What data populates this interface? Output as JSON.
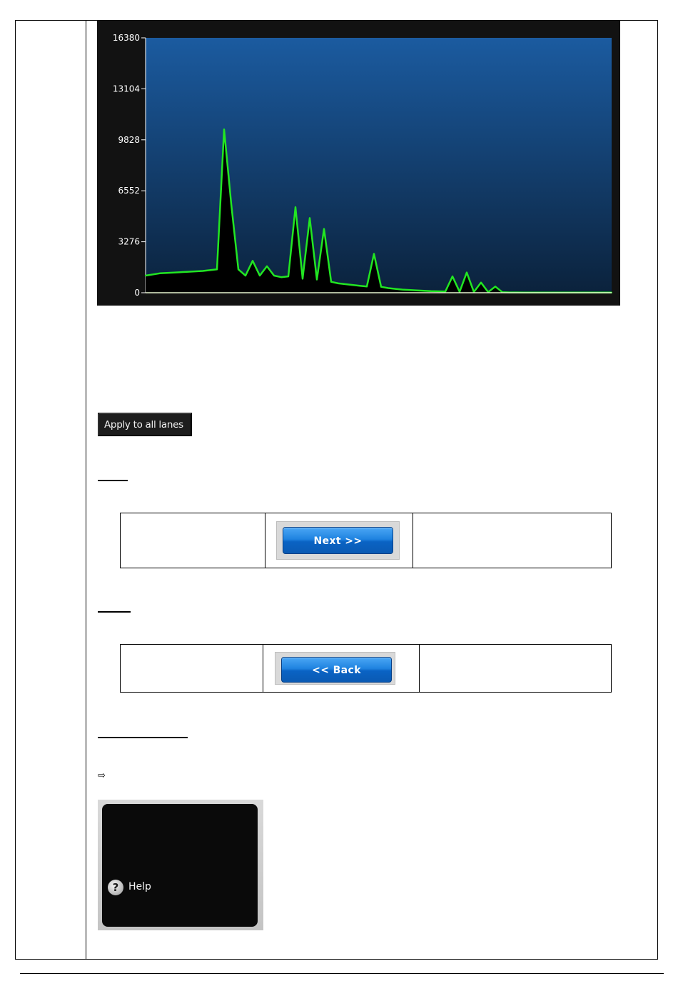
{
  "chart_data": {
    "type": "line",
    "title": "",
    "xlabel": "",
    "ylabel": "",
    "ylim": [
      0,
      16380
    ],
    "yticks": [
      0,
      3276,
      6552,
      9828,
      13104,
      16380
    ],
    "ytick_labels": [
      "0",
      "3276",
      "6552",
      "9828",
      "13104",
      "16380"
    ],
    "grid": false,
    "colors": {
      "background_top": "#1b5ba0",
      "background_bottom": "#0b223c",
      "trace": "#22e622",
      "baseline": "#000000"
    },
    "x": [
      0,
      20,
      40,
      60,
      80,
      100,
      110,
      120,
      130,
      140,
      150,
      160,
      170,
      180,
      190,
      200,
      210,
      220,
      230,
      240,
      250,
      260,
      270,
      280,
      290,
      300,
      310,
      320,
      330,
      340,
      350,
      360,
      380,
      400,
      420,
      430,
      440,
      450,
      460,
      470,
      480,
      490,
      500,
      510,
      520,
      530,
      540,
      560,
      580,
      600,
      620,
      640,
      653
    ],
    "series": [
      {
        "values": [
          1100,
          1250,
          1300,
          1350,
          1400,
          1500,
          10500,
          5700,
          1500,
          1100,
          2050,
          1100,
          1700,
          1100,
          1000,
          1050,
          5500,
          900,
          4800,
          850,
          4100,
          700,
          600,
          550,
          500,
          450,
          400,
          2500,
          380,
          300,
          250,
          200,
          150,
          100,
          80,
          1050,
          60,
          1300,
          50,
          650,
          40,
          400,
          30,
          20,
          20,
          10,
          10,
          10,
          10,
          10,
          10,
          10,
          10
        ]
      }
    ]
  },
  "apply_button": {
    "label": "Apply to all lanes"
  },
  "next_button": {
    "label": "Next  >>"
  },
  "back_button": {
    "label": "<< Back"
  },
  "arrow_glyph": "⇨",
  "help_panel": {
    "label": "Help",
    "icon": "help-question-icon",
    "icon_glyph": "?"
  }
}
